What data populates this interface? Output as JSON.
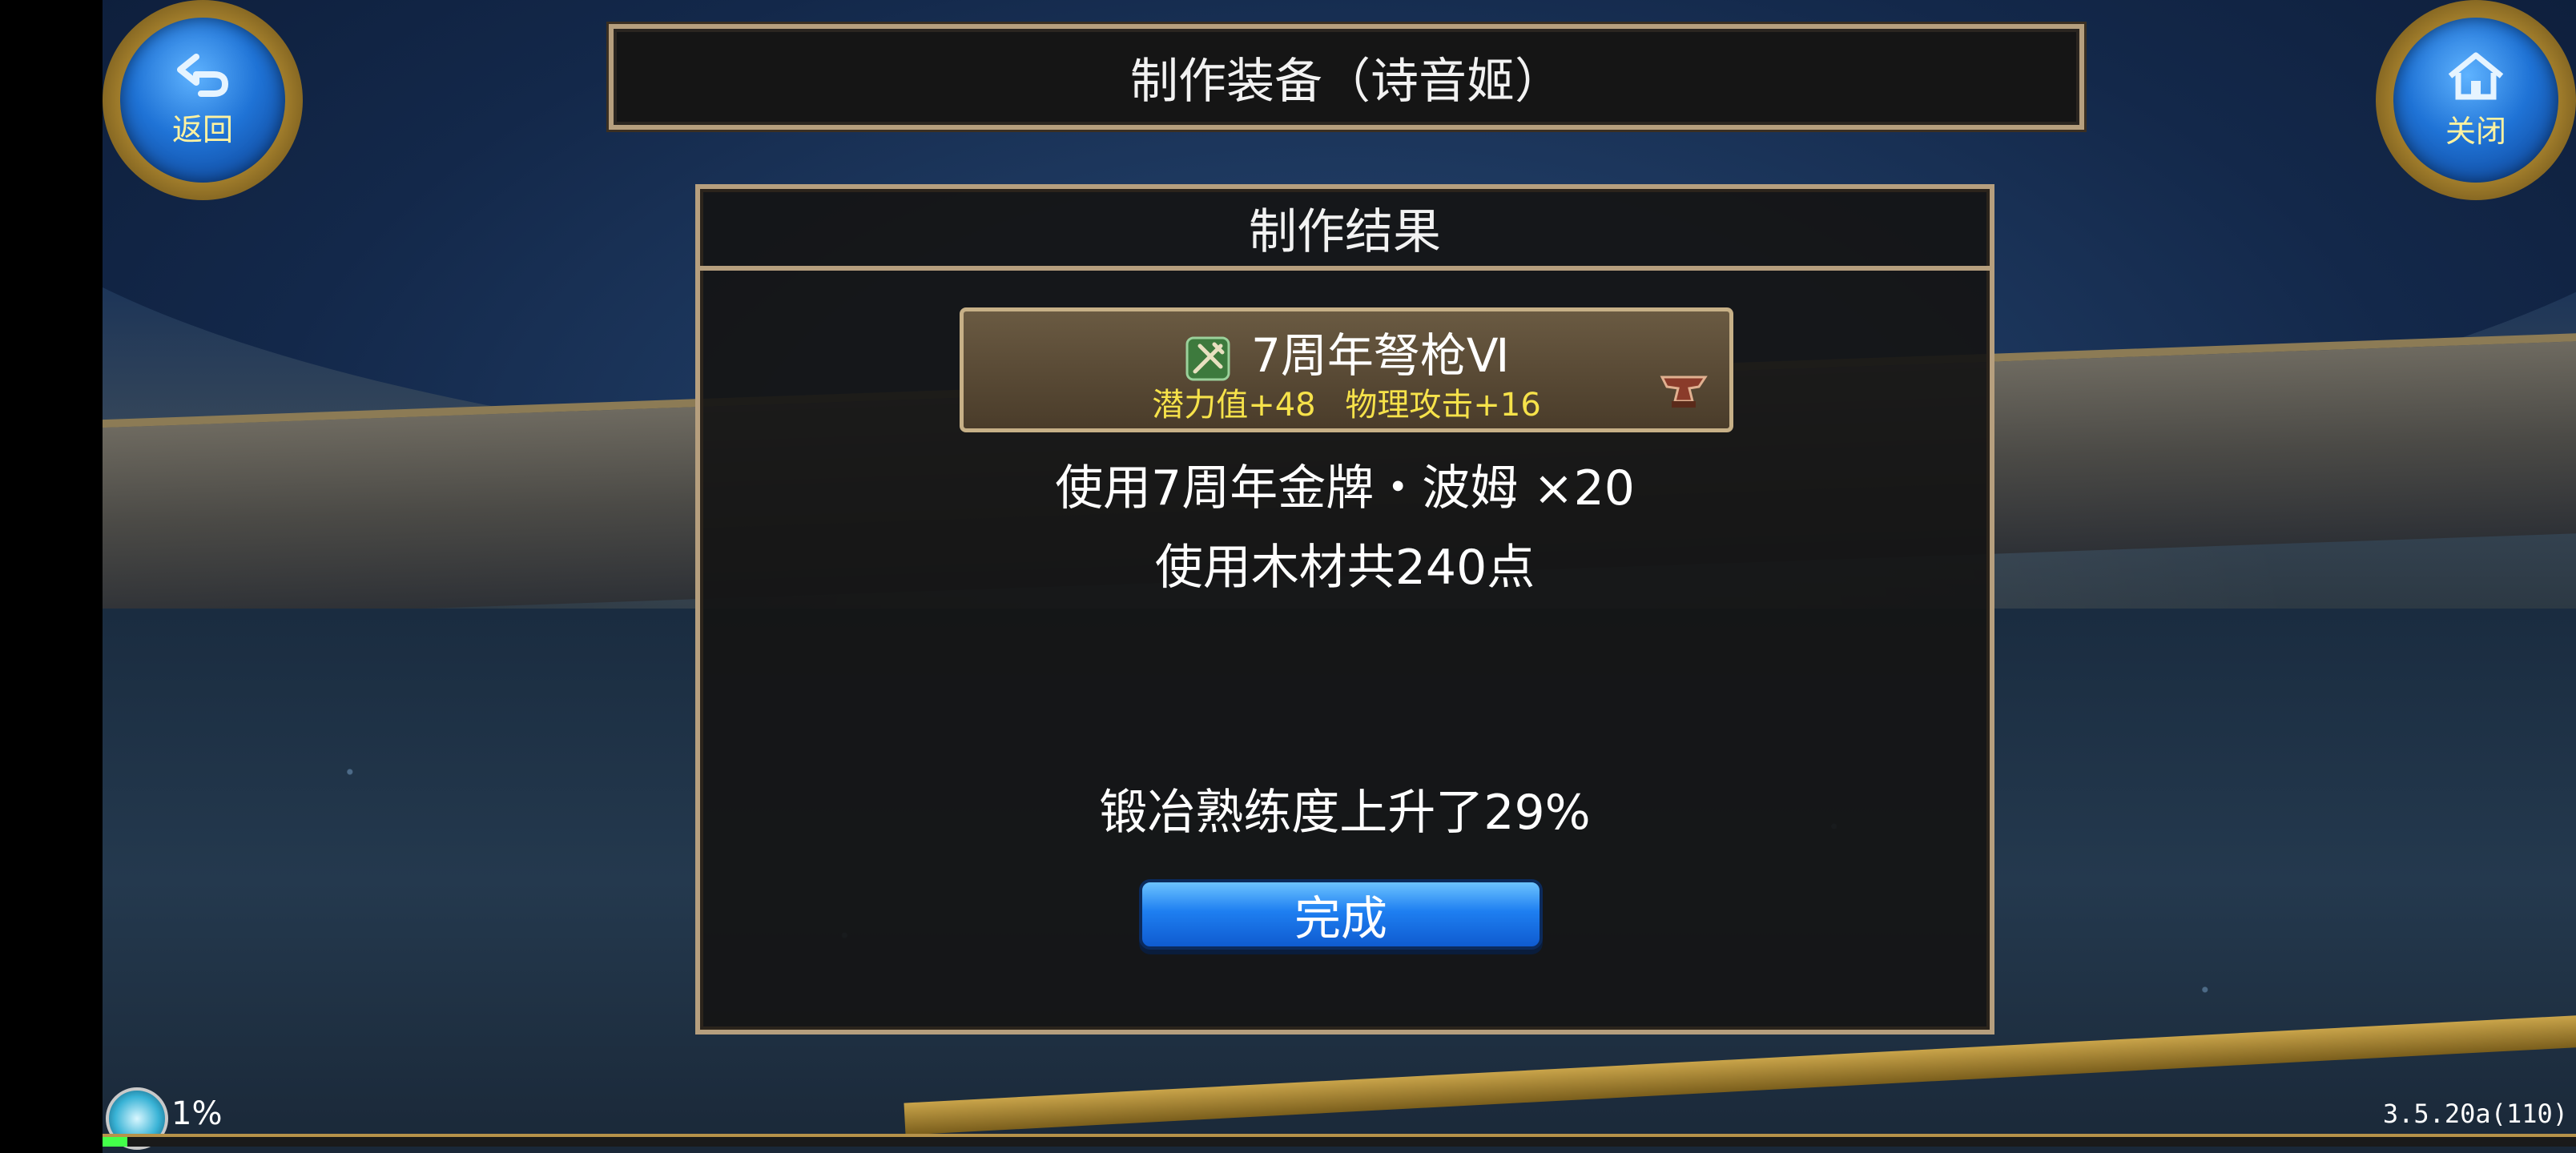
{
  "header": {
    "title": "制作装备（诗音姬）"
  },
  "corner_buttons": {
    "back": {
      "label": "返回",
      "icon": "back-arrow-icon"
    },
    "close": {
      "label": "关闭",
      "icon": "home-icon"
    }
  },
  "result": {
    "title": "制作结果",
    "item": {
      "name": "7周年弩枪Ⅵ",
      "stats": [
        "潜力值+48",
        "物理攻击+16"
      ],
      "icon": "crossbow-icon",
      "side_icon": "anvil-icon"
    },
    "used_medal": "使用7周年金牌・波姆 ×20",
    "used_wood": "使用木材共240点",
    "proficiency": "锻冶熟练度上升了29%",
    "done_label": "完成"
  },
  "status": {
    "percent": "1%",
    "progress": 0.01
  },
  "version": "3.5.20a(110)",
  "colors": {
    "panel_border": "#b69f7e",
    "stat_text": "#f6e24a",
    "done_button": "#1e7ff1",
    "exp_bar": "#43ff4a"
  }
}
